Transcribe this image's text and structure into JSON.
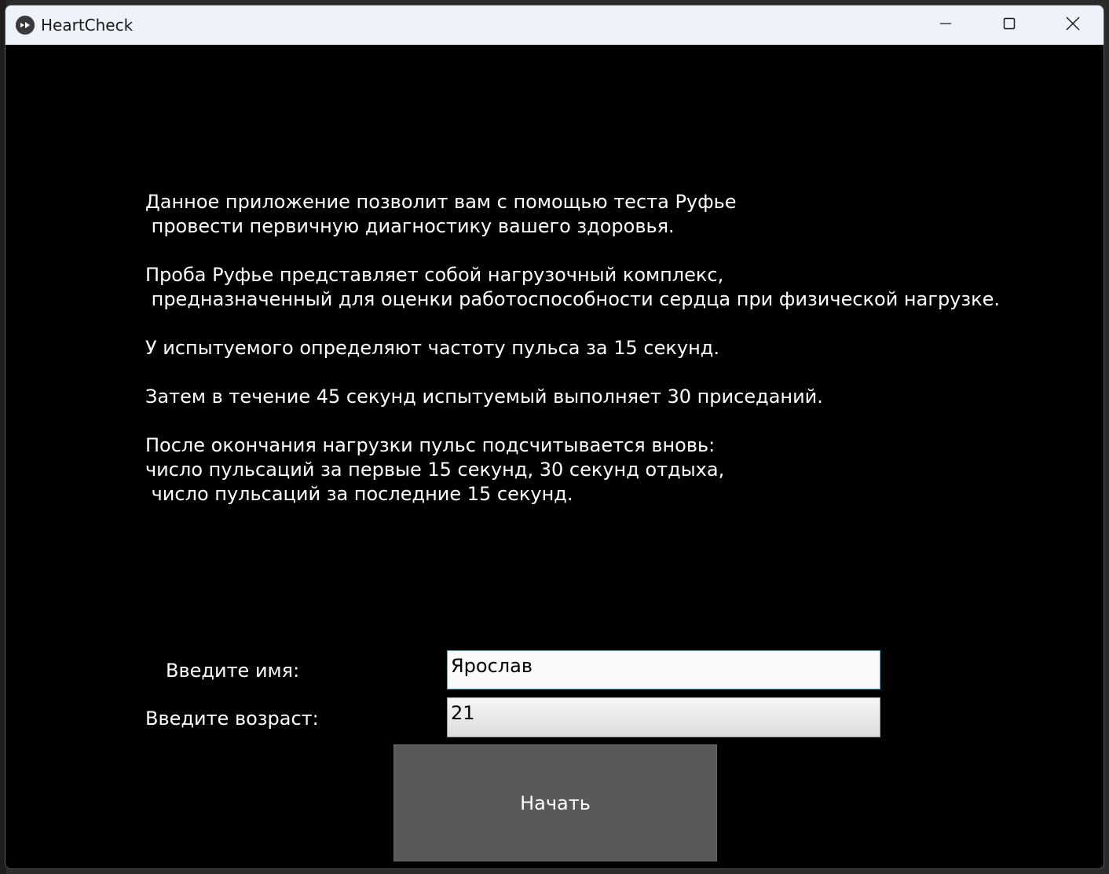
{
  "window": {
    "title": "HeartCheck",
    "icon": "kivy-app-icon"
  },
  "titlebar_controls": {
    "minimize": "minimize-icon",
    "maximize": "maximize-icon",
    "close": "close-icon"
  },
  "instructions": {
    "text": "Данное приложение позволит вам с помощью теста Руфье\n провести первичную диагностику вашего здоровья.\n\nПроба Руфье представляет собой нагрузочный комплекс,\n предназначенный для оценки работоспособности сердца при физической нагрузке.\n\nУ испытуемого определяют частоту пульса за 15 секунд.\n\nЗатем в течение 45 секунд испытуемый выполняет 30 приседаний.\n\nПосле окончания нагрузки пульс подсчитывается вновь:\nчисло пульсаций за первые 15 секунд, 30 секунд отдыха,\n число пульсаций за последние 15 секунд."
  },
  "form": {
    "name_label": "Введите имя:",
    "name_value": "Ярослав",
    "age_label": "Введите возраст:",
    "age_value": "21"
  },
  "actions": {
    "start_label": "Начать"
  },
  "colors": {
    "background": "#000000",
    "titlebar": "#eef2fb",
    "button": "#595959",
    "text": "#ffffff",
    "focus_border": "#41a9c9"
  }
}
